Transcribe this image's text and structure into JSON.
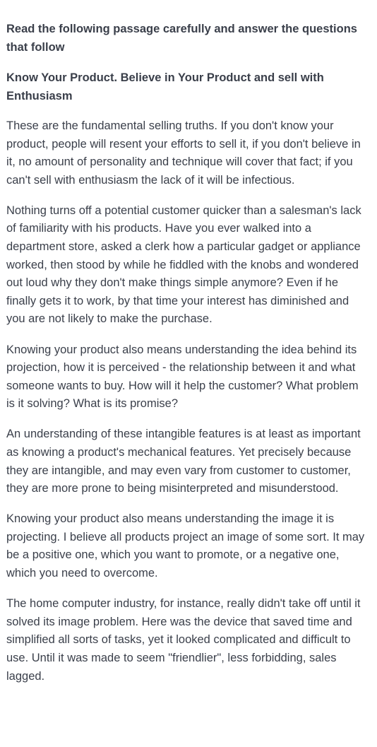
{
  "instruction": "Read the following passage carefully and answer the questions that follow",
  "heading": "Know Your Product. Believe in Your Product and sell with Enthusiasm",
  "paragraphs": [
    "These are the fundamental selling truths. If you don't know your product, people will resent your efforts to sell it, if you don't believe in it, no amount of personality and technique will cover that fact; if you can't sell with enthusiasm the lack of it will be infectious.",
    "Nothing turns off a potential customer quicker than a salesman's lack of familiarity with his products. Have you ever walked into a department store, asked a clerk how a particular gadget or appliance worked, then stood by while he fiddled with the knobs and wondered out loud why they don't make things simple anymore? Even if he finally gets it to work, by that time your interest has diminished and you are not likely to make the purchase.",
    "Knowing your product also means understanding the idea behind its projection, how it is perceived - the relationship between it and what someone wants to buy. How will it help the customer? What problem is it solving? What is its promise?",
    "An understanding of these intangible features is at least as important as knowing a product's mechanical features. Yet precisely because they are intangible, and may even vary from customer to customer, they are more prone to being misinterpreted and misunderstood.",
    "Knowing your product also means understanding the image it is projecting. I believe all products project an image of some sort. It may be a positive one, which you want to promote, or a negative one, which you need to overcome.",
    "The home computer industry, for instance, really didn't take off until it solved its image problem. Here was the device that saved time and simplified all sorts of tasks, yet it looked complicated and difficult to use. Until it was made to seem \"friendlier\", less forbidding, sales lagged."
  ]
}
